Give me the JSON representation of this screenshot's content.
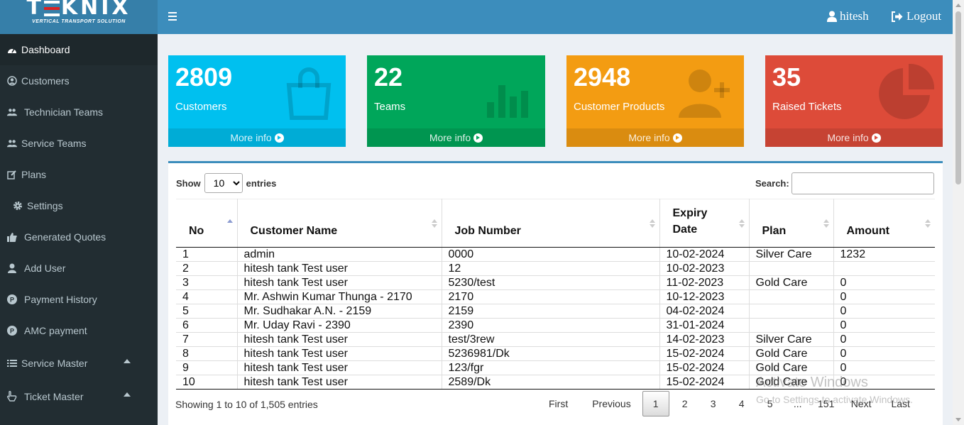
{
  "brand": {
    "name_prefix": "T",
    "name_suffix": "KNIX",
    "tagline": "VERTICAL TRANSPORT SOLUTION"
  },
  "sidebar": {
    "items": [
      {
        "label": "Dashboard",
        "icon": "dashboard-icon"
      },
      {
        "label": "Customers",
        "icon": "user-circle-icon"
      },
      {
        "label": "Technician Teams",
        "icon": "users-icon"
      },
      {
        "label": "Service Teams",
        "icon": "users-icon"
      },
      {
        "label": "Plans",
        "icon": "edit-icon"
      },
      {
        "label": "Settings",
        "icon": "gear-icon"
      },
      {
        "label": "Generated Quotes",
        "icon": "thumbs-up-icon"
      },
      {
        "label": "Add User",
        "icon": "user-icon"
      },
      {
        "label": "Payment History",
        "icon": "p-circle-icon"
      },
      {
        "label": "AMC payment",
        "icon": "p-circle-icon"
      },
      {
        "label": "Service Master",
        "icon": "list-icon"
      },
      {
        "label": "Ticket Master",
        "icon": "hand-icon"
      }
    ]
  },
  "header": {
    "username": "hitesh",
    "logout": "Logout"
  },
  "stats": [
    {
      "value": "2809",
      "label": "Customers",
      "more": "More info",
      "color": "#00c0ef"
    },
    {
      "value": "22",
      "label": "Teams",
      "more": "More info",
      "color": "#00a65a"
    },
    {
      "value": "2948",
      "label": "Customer Products",
      "more": "More info",
      "color": "#f39c12"
    },
    {
      "value": "35",
      "label": "Raised Tickets",
      "more": "More info",
      "color": "#dd4b39"
    }
  ],
  "table_controls": {
    "show": "Show",
    "entries_value": "10",
    "entries": "entries",
    "search": "Search:"
  },
  "table": {
    "columns": [
      "No",
      "Customer Name",
      "Job Number",
      "Expiry Date",
      "Plan",
      "Amount"
    ],
    "rows": [
      [
        "1",
        "admin",
        "0000",
        "10-02-2024",
        "Silver Care",
        "1232"
      ],
      [
        "2",
        "hitesh tank Test user",
        "12",
        "10-02-2023",
        "",
        ""
      ],
      [
        "3",
        "hitesh tank Test user",
        "5230/test",
        "11-02-2023",
        "Gold Care",
        "0"
      ],
      [
        "4",
        "Mr. Ashwin Kumar Thunga - 2170",
        "2170",
        "10-12-2023",
        "",
        "0"
      ],
      [
        "5",
        "Mr. Sudhakar A.N. - 2159",
        "2159",
        "04-02-2024",
        "",
        "0"
      ],
      [
        "6",
        "Mr. Uday Ravi - 2390",
        "2390",
        "31-01-2024",
        "",
        "0"
      ],
      [
        "7",
        "hitesh tank Test user",
        "test/3rew",
        "14-02-2023",
        "Silver Care",
        "0"
      ],
      [
        "8",
        "hitesh tank Test user",
        "5236981/Dk",
        "15-02-2024",
        "Gold Care",
        "0"
      ],
      [
        "9",
        "hitesh tank Test user",
        "123/fgr",
        "15-02-2024",
        "Gold Care",
        "0"
      ],
      [
        "10",
        "hitesh tank Test user",
        "2589/Dk",
        "15-02-2024",
        "Gold Care",
        "0"
      ]
    ]
  },
  "footer": {
    "info": "Showing 1 to 10 of 1,505 entries",
    "pages": [
      "First",
      "Previous",
      "1",
      "2",
      "3",
      "4",
      "5",
      "...",
      "151",
      "Next",
      "Last"
    ],
    "current": "1"
  },
  "watermark": {
    "line1": "Activate Windows",
    "line2": "Go to Settings to activate Windows."
  }
}
